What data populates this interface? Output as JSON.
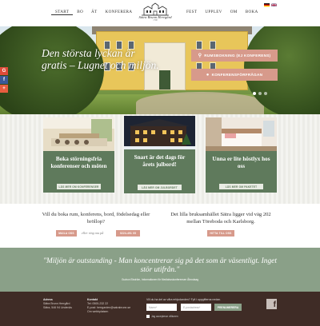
{
  "nav": {
    "left": [
      "START",
      "BO",
      "ÄT",
      "KONFERERA"
    ],
    "right": [
      "FEST",
      "UPPLEV",
      "OM",
      "BOKA"
    ]
  },
  "logo": {
    "name": "Sätra Brunn Herrgård",
    "sub": "1700"
  },
  "hero": {
    "title": "Den största lyckan är gratis – Lugnet och miljön.",
    "btn_room": "RUMSBOKNING (EJ KONFERENS)",
    "btn_conf": "KONFERENSFÖRFRÅGAN",
    "slides": 3,
    "active_slide": 0
  },
  "social": [
    {
      "icon": "google-icon",
      "glyph": "G",
      "color": "#dd4b39"
    },
    {
      "icon": "facebook-icon",
      "glyph": "f",
      "color": "#3b5998"
    },
    {
      "icon": "plus-icon",
      "glyph": "+",
      "color": "#e85d3f"
    }
  ],
  "cards": [
    {
      "title": "Boka störningsfria konferenser och möten",
      "button": "LÄS MER OM KONFERENSER"
    },
    {
      "title": "Snart är det dags för årets julbord!",
      "button": "LÄS MER OM JULBORDET"
    },
    {
      "title": "Unna er lite höstlyx hos oss",
      "button": "LÄS MER OM PAKETET"
    }
  ],
  "info": {
    "left_title": "Vill du boka rum, konferens, bord, födelsedag eller bröllop?",
    "left_btn1": "MAILA OSS",
    "left_or": "eller ring oss på",
    "left_btn2": "0224-491 05",
    "right_title": "Det lilla bruksamhället Sätra ligger vid väg 202 mellan Töreboda och Karlsborg.",
    "right_btn": "HITTA TILL OSS"
  },
  "quote": {
    "text": "\"Miljön är outstanding - Man koncentrerar sig på det som är väsentligt. Inget stör utifrån.\"",
    "author": "Gudrun Ekström, Informationen för Mediahuskonferensen Åbrodaag"
  },
  "footer": {
    "address_head": "Adress",
    "address": [
      "Sätra Brunn Herrgård",
      "Sätra, 546 94 Undenäs"
    ],
    "contact_head": "Kontakt",
    "contact": [
      "Tel: 0505-232 22",
      "E-post: herrgarden@satrabrunn.se",
      "Om webbplatsen"
    ],
    "newsletter_label": "Vill du ha del av våra erbjudanden? Fyll i uppgifterna nedan.",
    "name_placeholder": "Namn*",
    "email_placeholder": "E-postadress*",
    "submit": "PRENUMERERA",
    "consent": "Jag accepterar villkoren"
  },
  "colors": {
    "accent_pink": "#d79a8b",
    "green": "#5f7a5c",
    "footer_bg": "#3f2c26"
  }
}
